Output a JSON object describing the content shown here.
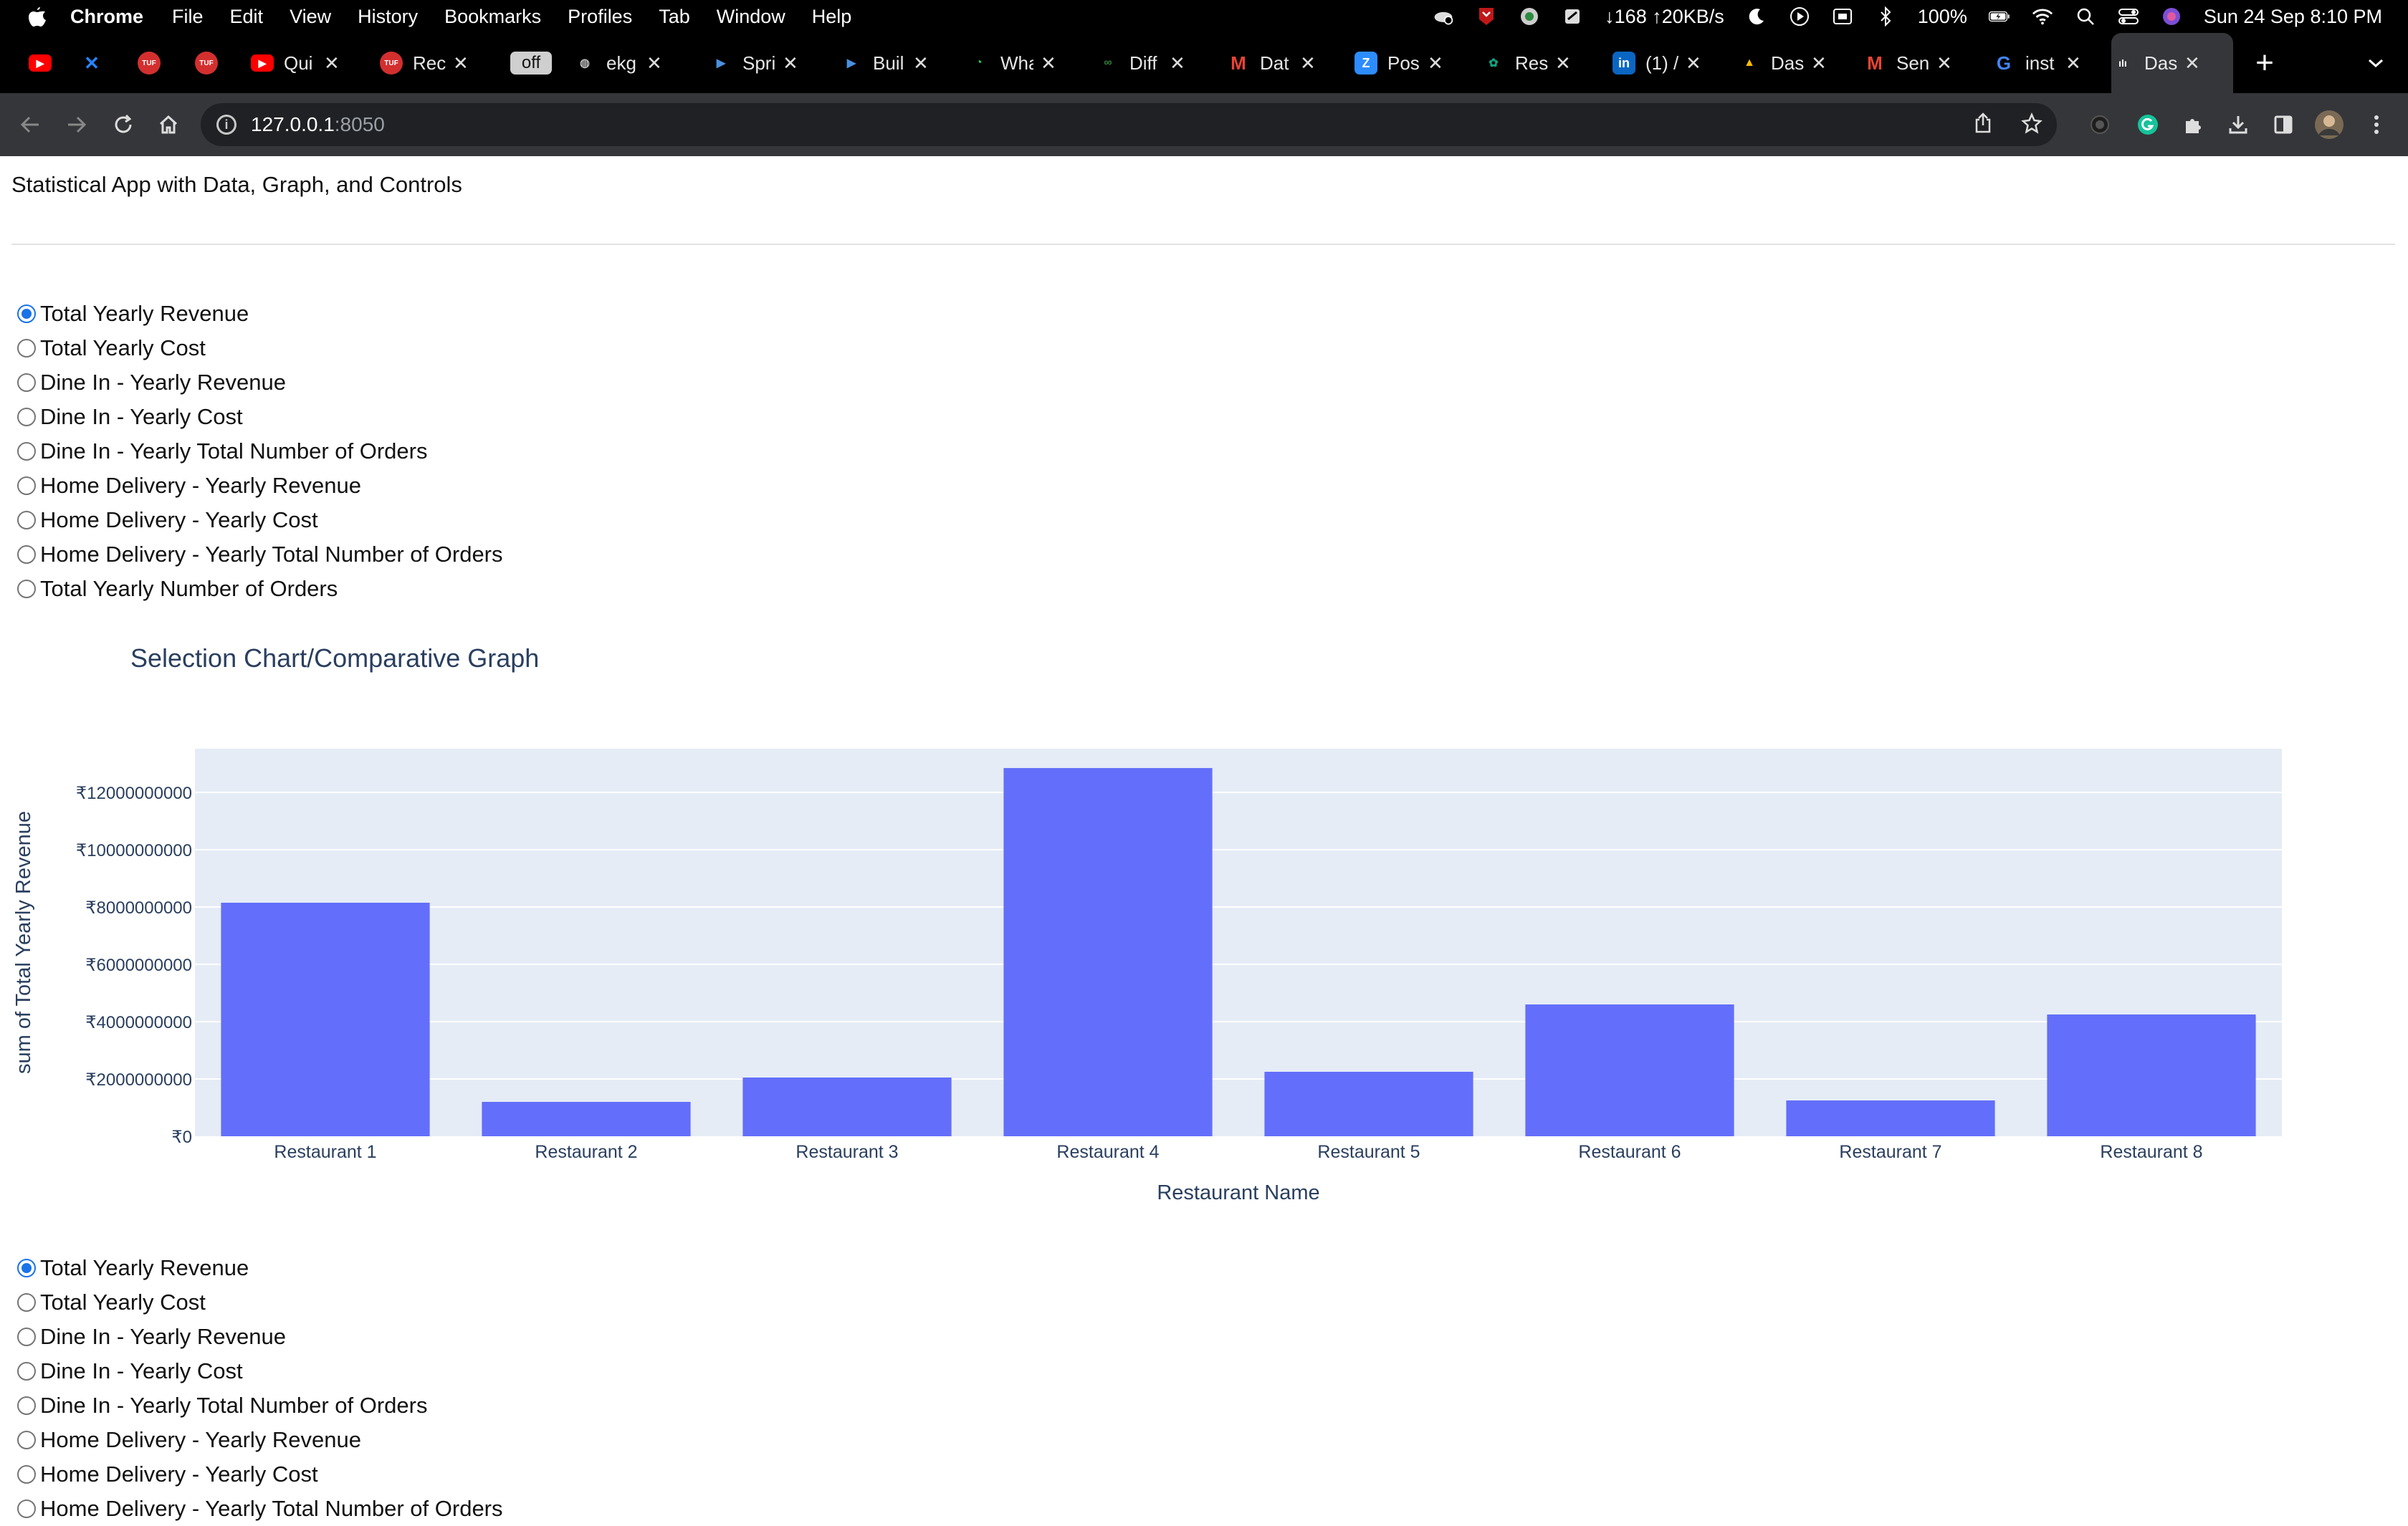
{
  "menubar": {
    "app_name": "Chrome",
    "items": [
      "File",
      "Edit",
      "View",
      "History",
      "Bookmarks",
      "Profiles",
      "Tab",
      "Window",
      "Help"
    ],
    "network": "↓168 ↑20KB/s",
    "battery": "100%",
    "datetime": "Sun 24 Sep  8:10 PM"
  },
  "tabs": [
    {
      "label": "",
      "icon": "youtube-icon",
      "color": "#ff0000"
    },
    {
      "label": "",
      "icon": "confluence-icon",
      "color": "#2684ff"
    },
    {
      "label": "",
      "icon": "tuf-icon",
      "color": "#d32f2f"
    },
    {
      "label": "",
      "icon": "tuf-icon",
      "color": "#d32f2f"
    },
    {
      "label": "Qui",
      "icon": "youtube-icon",
      "color": "#ff0000"
    },
    {
      "label": "Rec",
      "icon": "tuf-icon",
      "color": "#d32f2f"
    },
    {
      "label": "off",
      "icon": "off-badge",
      "color": "#cfcfcf"
    },
    {
      "label": "ekg",
      "icon": "globe-icon",
      "color": "#bbbbbb"
    },
    {
      "label": "Spri",
      "icon": "video-icon",
      "color": "#4a90e2"
    },
    {
      "label": "Buil",
      "icon": "video-icon",
      "color": "#4a90e2"
    },
    {
      "label": "Wha",
      "icon": "whatsapp-icon",
      "color": "#25d366"
    },
    {
      "label": "Diff",
      "icon": "infinity-icon",
      "color": "#2e7d32"
    },
    {
      "label": "Dat",
      "icon": "gmail-icon",
      "color": "#ea4335"
    },
    {
      "label": "Pos",
      "icon": "zoom-icon",
      "color": "#2d8cff"
    },
    {
      "label": "Res",
      "icon": "chatgpt-icon",
      "color": "#10a37f"
    },
    {
      "label": "(1) /",
      "icon": "linkedin-icon",
      "color": "#0a66c2"
    },
    {
      "label": "Das",
      "icon": "drive-icon",
      "color": "#fbbc04"
    },
    {
      "label": "Sen",
      "icon": "gmail-icon",
      "color": "#ea4335"
    },
    {
      "label": "inst",
      "icon": "google-icon",
      "color": "#4285f4"
    },
    {
      "label": "Das",
      "icon": "dash-icon",
      "color": "#ffffff"
    }
  ],
  "address_bar": {
    "host": "127.0.0.1",
    "port": ":8050"
  },
  "app": {
    "title": "Statistical App with Data, Graph, and Controls",
    "radio_options": [
      "Total Yearly Revenue",
      "Total Yearly Cost",
      "Dine In - Yearly Revenue",
      "Dine In - Yearly Cost",
      "Dine In - Yearly Total Number of Orders",
      "Home Delivery - Yearly Revenue",
      "Home Delivery - Yearly Cost",
      "Home Delivery - Yearly Total Number of Orders",
      "Total Yearly Number of Orders"
    ],
    "selected_index": 0,
    "bottom_radio_partial": "Home Delivery - Yearly Total Number of Orders"
  },
  "chart_data": {
    "type": "bar",
    "title": "Selection Chart/Comparative Graph",
    "xlabel": "Restaurant Name",
    "ylabel": "sum of Total Yearly Revenue",
    "categories": [
      "Restaurant 1",
      "Restaurant 2",
      "Restaurant 3",
      "Restaurant 4",
      "Restaurant 5",
      "Restaurant 6",
      "Restaurant 7",
      "Restaurant 8"
    ],
    "values": [
      8150000000,
      1200000000,
      2050000000,
      12850000000,
      2250000000,
      4600000000,
      1250000000,
      4250000000
    ],
    "yticks": [
      0,
      2000000000,
      4000000000,
      6000000000,
      8000000000,
      10000000000,
      12000000000
    ],
    "ytick_labels": [
      "₹0",
      "₹2000000000",
      "₹4000000000",
      "₹6000000000",
      "₹8000000000",
      "₹10000000000",
      "₹12000000000"
    ],
    "ylim": [
      0,
      13526000000
    ],
    "grid": true,
    "bar_color": "#636efa",
    "plot_bg": "#e5ecf6"
  }
}
